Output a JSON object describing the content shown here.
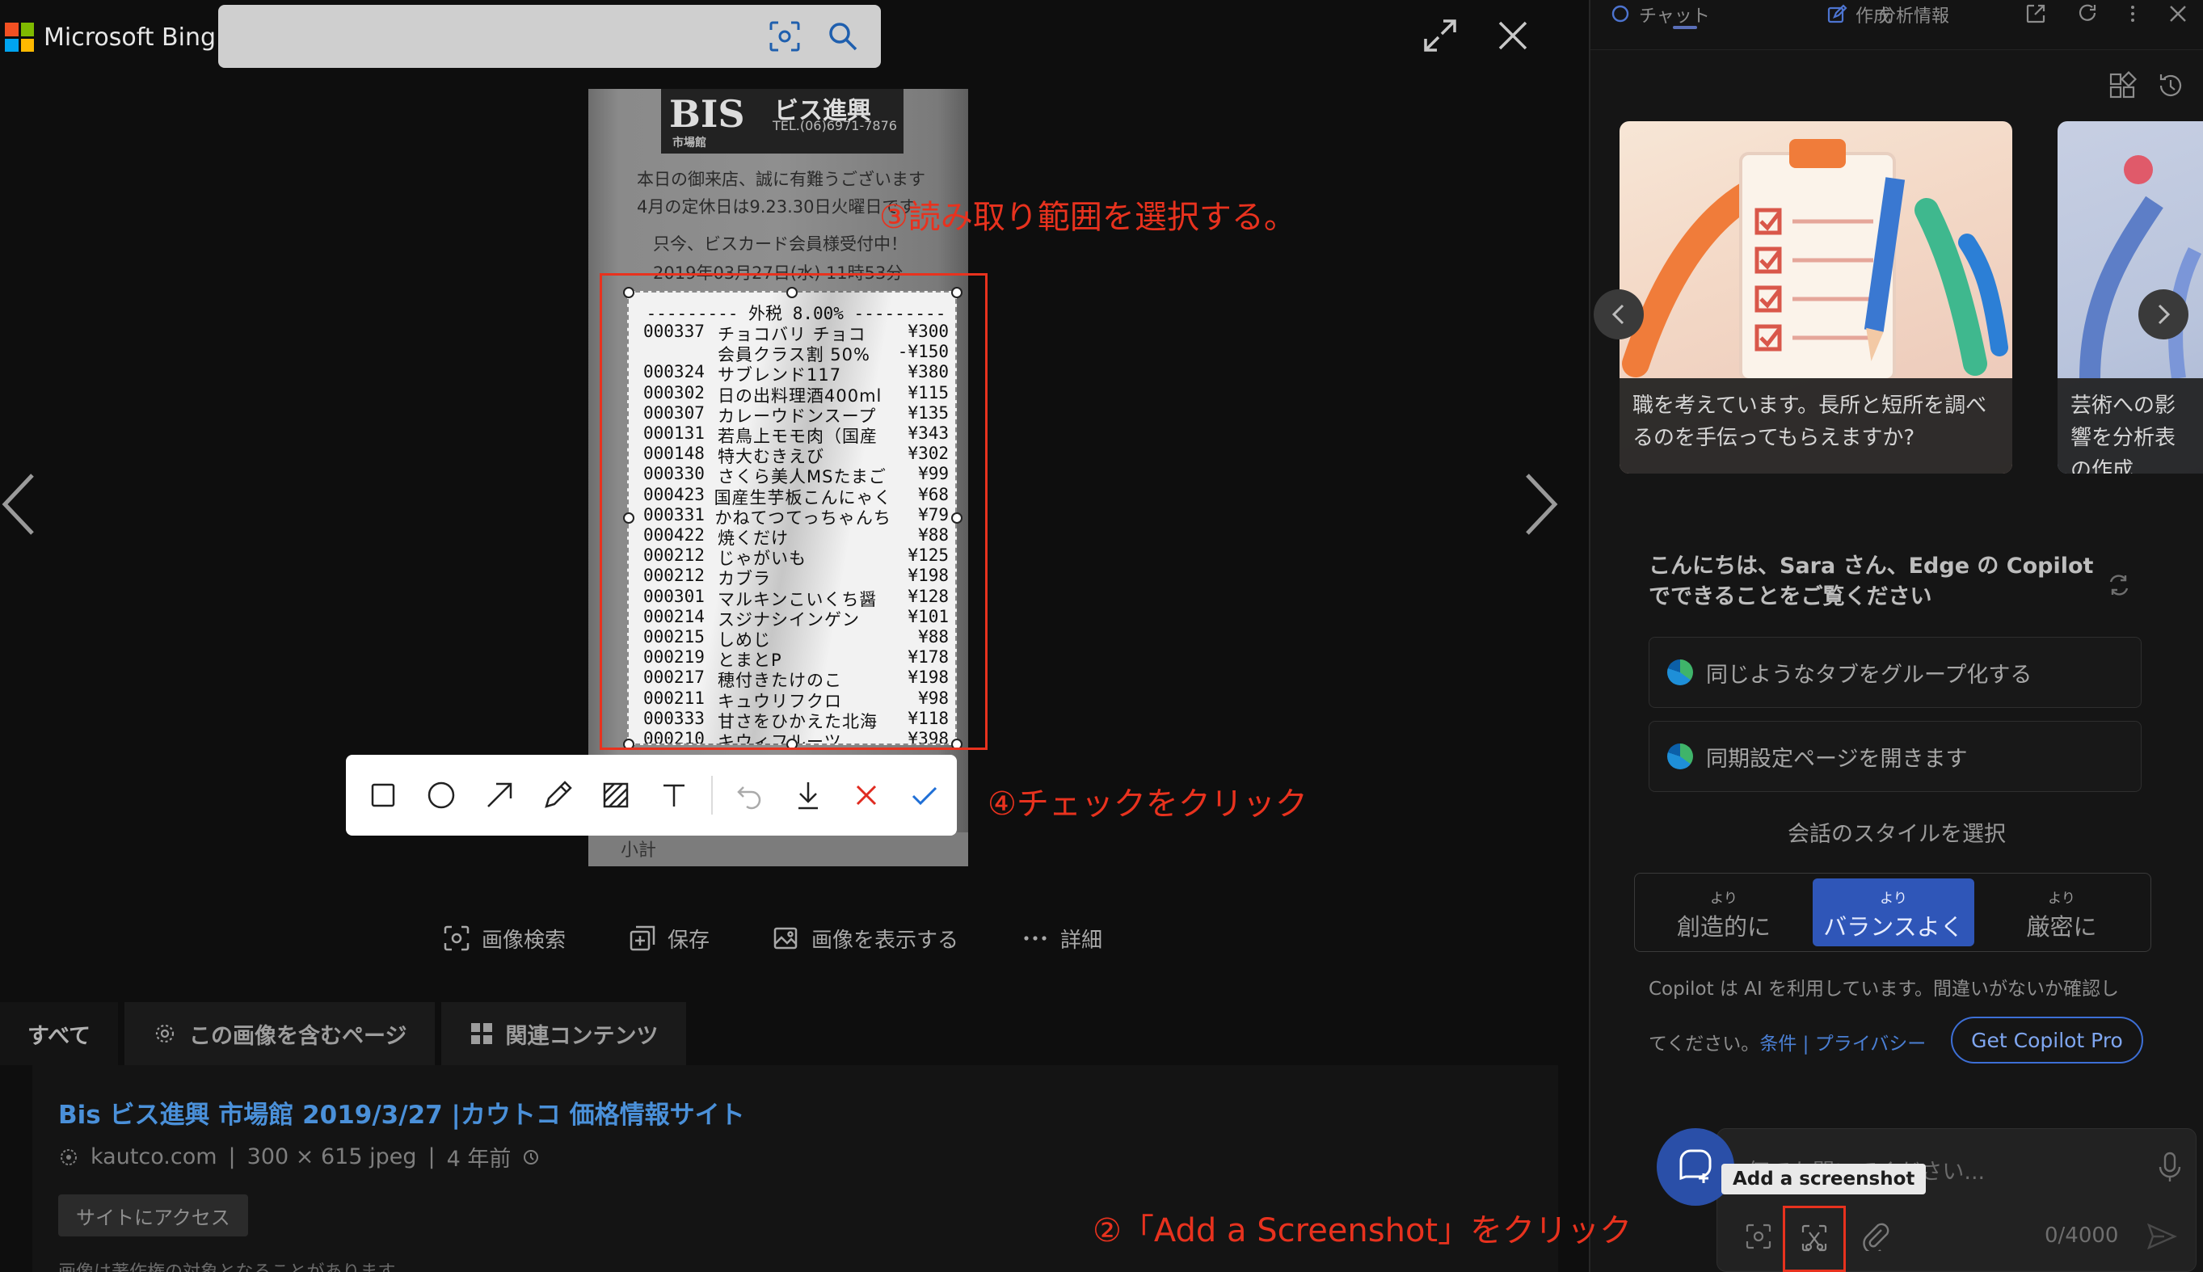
{
  "bing": {
    "logo_text": "Microsoft Bing",
    "logo_colors": [
      "#f25022",
      "#7fba00",
      "#00a4ef",
      "#ffb900"
    ]
  },
  "receipt": {
    "header": "BIS",
    "store": "ビス進興",
    "subtitle": "市場館",
    "tel": "TEL.(06)6971-7876",
    "lines": [
      "本日の御来店、誠に有難うございます",
      "4月の定休日は9.23.30日火曜日です",
      "只今、ビスカード会員様受付中！",
      "2019年03月27日(水)    11時53分"
    ],
    "tax_line": "--------- 外税  8.00% ---------",
    "items": [
      {
        "code": "000337",
        "name": "チョコバリ チョコ",
        "price": "¥300"
      },
      {
        "code": "",
        "name": "会員クラス割     50%",
        "price": "-¥150"
      },
      {
        "code": "000324",
        "name": "サブレンド117",
        "price": "¥380"
      },
      {
        "code": "000302",
        "name": "日の出料理酒400ml",
        "price": "¥115"
      },
      {
        "code": "000307",
        "name": "カレーウドンスープ",
        "price": "¥135"
      },
      {
        "code": "000131",
        "name": "若鳥上モモ肉（国産",
        "price": "¥343"
      },
      {
        "code": "000148",
        "name": "特大むきえび",
        "price": "¥302"
      },
      {
        "code": "000330",
        "name": "さくら美人MSたまご",
        "price": "¥99"
      },
      {
        "code": "000423",
        "name": "国産生芋板こんにゃく",
        "price": "¥68"
      },
      {
        "code": "000331",
        "name": "かねてつてっちゃんち",
        "price": "¥79"
      },
      {
        "code": "000422",
        "name": "焼くだけ",
        "price": "¥88"
      },
      {
        "code": "000212",
        "name": "じゃがいも",
        "price": "¥125"
      },
      {
        "code": "000212",
        "name": "カブラ",
        "price": "¥198"
      },
      {
        "code": "000301",
        "name": "マルキンこいくち醤",
        "price": "¥128"
      },
      {
        "code": "000214",
        "name": "スジナシインゲン",
        "price": "¥101"
      },
      {
        "code": "000215",
        "name": "しめじ",
        "price": "¥88"
      },
      {
        "code": "000219",
        "name": "とまとP",
        "price": "¥178"
      },
      {
        "code": "000217",
        "name": "穂付きたけのこ",
        "price": "¥198"
      },
      {
        "code": "000211",
        "name": "キュウリフクロ",
        "price": "¥98"
      },
      {
        "code": "000333",
        "name": "甘さをひかえた北海",
        "price": "¥118"
      },
      {
        "code": "000210",
        "name": "キウィフルーツ",
        "price": "¥398"
      }
    ],
    "below_text": "小計"
  },
  "annotations": {
    "step3": "③読み取り範囲を選択する。",
    "step4": "④チェックをクリック",
    "step2": "②「Add a Screenshot」をクリック",
    "color": "#e8321e"
  },
  "toolbar": {
    "tools": [
      "rectangle-icon",
      "circle-icon",
      "arrow-icon",
      "pencil-icon",
      "mosaic-icon",
      "text-icon",
      "undo-icon",
      "download-icon",
      "cancel-icon",
      "check-icon"
    ]
  },
  "actions": {
    "image_search": "画像検索",
    "save": "保存",
    "view_image": "画像を表示する",
    "details": "詳細"
  },
  "tabs": {
    "all": "すべて",
    "pages_with_image": "この画像を含むページ",
    "related": "関連コンテンツ"
  },
  "result": {
    "title": "Bis ビス進興 市場館 2019/3/27 |カウトコ 価格情報サイト",
    "site": "kautco.com",
    "size": "300 × 615 jpeg",
    "age": "4 年前",
    "visit": "サイトにアクセス",
    "note": "画像は著作権の対象となることがあります。"
  },
  "copilot": {
    "tabs": {
      "chat": "チャット",
      "compose": "作成",
      "insights": "分析情報"
    },
    "card1": "職を考えています。長所と短所を調べるのを手伝ってもらえますか?",
    "card2": "芸術への影響を分析表の作成",
    "greeting": "こんにちは、Sara さん、Edge の Copilot でできることをご覧ください",
    "suggestions": [
      "同じようなタブをグループ化する",
      "同期設定ページを開きます"
    ],
    "style_heading": "会話のスタイルを選択",
    "styles": [
      {
        "yori": "より",
        "label": "創造的に"
      },
      {
        "yori": "より",
        "label": "バランスよく"
      },
      {
        "yori": "より",
        "label": "厳密に"
      }
    ],
    "notice_1": "Copilot は AI を利用しています。間違いがないか確認し",
    "notice_2a": "てください。",
    "terms": "条件",
    "sep": " | ",
    "privacy": "プライバシー",
    "get_pro": "Get Copilot Pro",
    "input_placeholder": "何でも聞いてください...",
    "tooltip": "Add a screenshot",
    "char_count": "0/4000",
    "accent": "#2f56b8"
  }
}
